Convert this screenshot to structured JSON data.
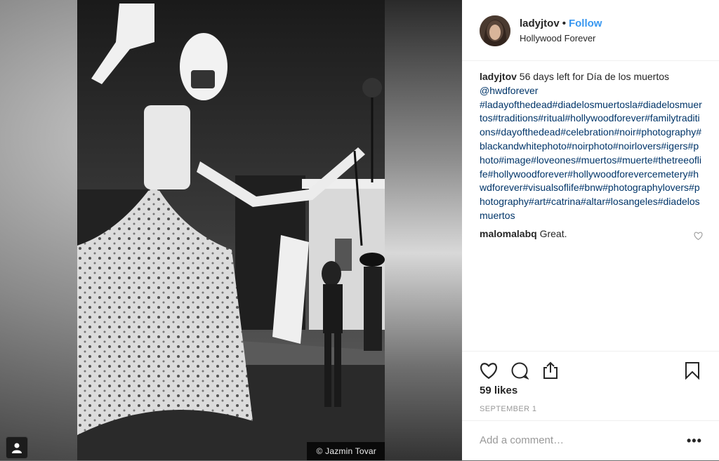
{
  "image": {
    "credit": "© Jazmin Tovar"
  },
  "header": {
    "username": "ladyjtov",
    "separator": "•",
    "follow_label": "Follow",
    "location": "Hollywood Forever"
  },
  "caption": {
    "username": "ladyjtov",
    "text": "56 days left for Día de los muertos",
    "mention": "@hwdforever",
    "hashtags": "#ladayofthedead#diadelosmuertosla#diadelosmuertos#traditions#ritual#hollywoodforever#familytraditions#dayofthedead#celebration#noir#photography#blackandwhitephoto#noirphoto#noirlovers#igers#photo#image#loveones#muertos#muerte#thetreeoflife#hollywoodforever#hollywoodforevercemetery#hwdforever#visualsoflife#bnw#photographylovers#photography#art#catrina#altar#losangeles#diadelosmuertos"
  },
  "comments": [
    {
      "username": "malomalabq",
      "text": "Great."
    }
  ],
  "actions": {
    "like_icon": "heart-icon",
    "comment_icon": "comment-icon",
    "share_icon": "share-icon",
    "save_icon": "bookmark-icon"
  },
  "likes": "59 likes",
  "date": "SEPTEMBER 1",
  "add_comment": {
    "placeholder": "Add a comment…",
    "more_label": "•••"
  }
}
